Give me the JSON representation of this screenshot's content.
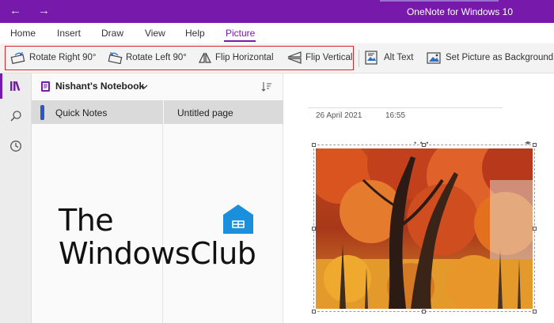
{
  "app": {
    "title": "OneNote for Windows 10"
  },
  "menu": {
    "tabs": [
      "Home",
      "Insert",
      "Draw",
      "View",
      "Help",
      "Picture"
    ],
    "active": "Picture"
  },
  "ribbon": {
    "rotate_right": "Rotate Right 90°",
    "rotate_left": "Rotate Left 90°",
    "flip_horizontal": "Flip Horizontal",
    "flip_vertical": "Flip Vertical",
    "alt_text": "Alt Text",
    "set_background": "Set Picture as Background"
  },
  "notebook": {
    "name": "Nishant's Notebook",
    "sections": [
      {
        "label": "Quick Notes",
        "color": "#2b57c6"
      }
    ],
    "pages": [
      {
        "label": "Untitled page"
      }
    ]
  },
  "page": {
    "date": "26 April 2021",
    "time": "16:55"
  },
  "watermark": {
    "line1": "The",
    "line2": "WindowsClub"
  },
  "colors": {
    "accent": "#7719aa",
    "highlight_box": "#e0242a"
  }
}
